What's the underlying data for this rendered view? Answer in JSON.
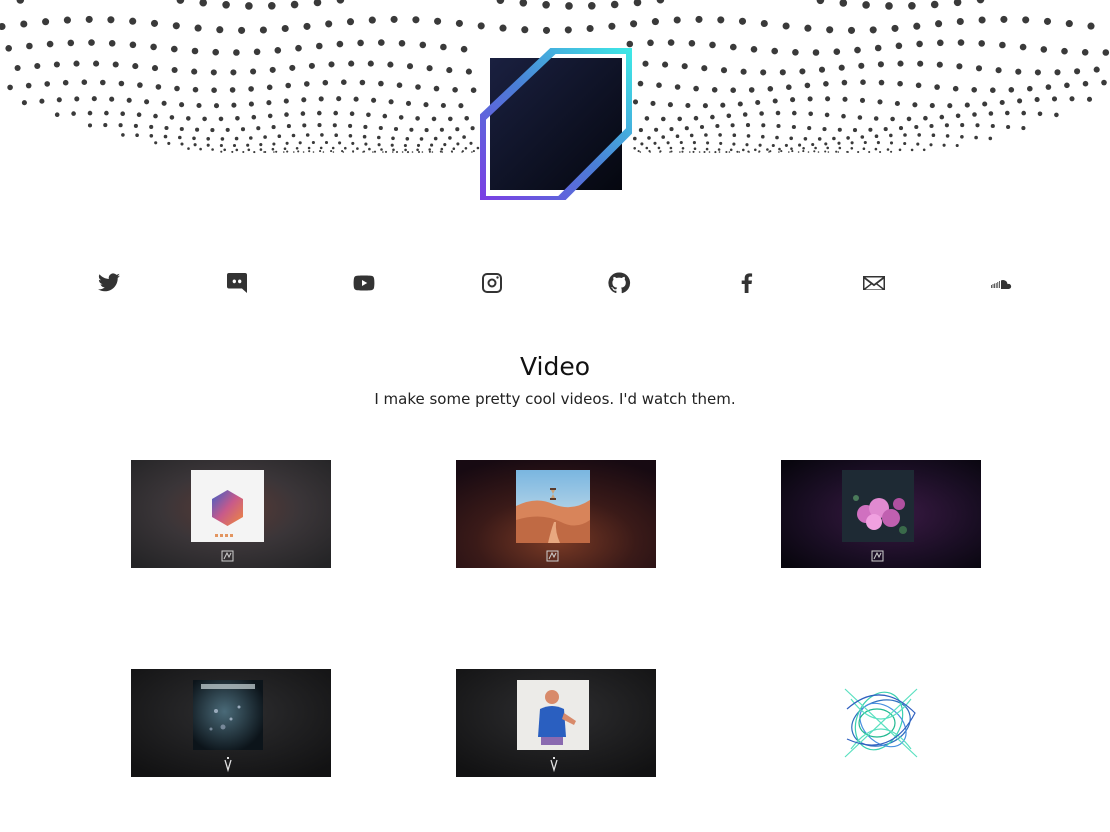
{
  "header": {
    "logo": "diamond-logo",
    "accent_colors": [
      "#7b3fe4",
      "#4a7fd6",
      "#3ee8e6"
    ],
    "logo_fill": "#0d1224"
  },
  "social": [
    {
      "name": "twitter-icon"
    },
    {
      "name": "discord-icon"
    },
    {
      "name": "youtube-icon"
    },
    {
      "name": "instagram-icon"
    },
    {
      "name": "github-icon"
    },
    {
      "name": "facebook-icon"
    },
    {
      "name": "email-icon"
    },
    {
      "name": "soundcloud-icon"
    }
  ],
  "section": {
    "title": "Video",
    "subtitle": "I make some pretty cool videos. I'd watch them."
  },
  "videos": [
    {
      "name": "video-thumb-hexagon"
    },
    {
      "name": "video-thumb-desert"
    },
    {
      "name": "video-thumb-flowers"
    },
    {
      "name": "video-thumb-dark-cover"
    },
    {
      "name": "video-thumb-figure"
    },
    {
      "name": "video-thumb-scribble"
    }
  ]
}
